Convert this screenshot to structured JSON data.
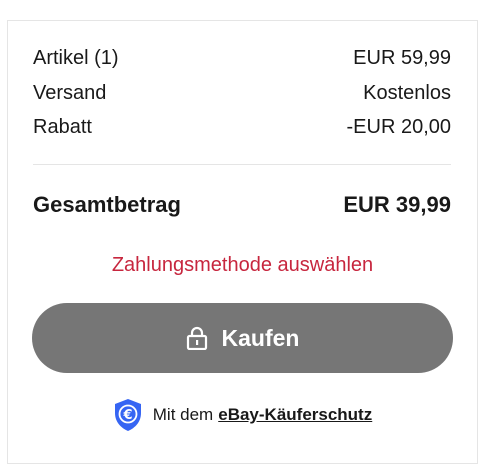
{
  "summary": {
    "items_label": "Artikel (1)",
    "items_value": "EUR 59,99",
    "shipping_label": "Versand",
    "shipping_value": "Kostenlos",
    "discount_label": "Rabatt",
    "discount_value": "-EUR 20,00",
    "total_label": "Gesamtbetrag",
    "total_value": "EUR 39,99"
  },
  "payment_warning": "Zahlungsmethode auswählen",
  "buy_button": {
    "label": "Kaufen",
    "icon": "lock-icon",
    "color": "#767676"
  },
  "protection": {
    "icon": "euro-shield-icon",
    "prefix": "Mit dem",
    "link": "eBay-Käuferschutz",
    "icon_color": "#3665f3"
  },
  "colors": {
    "warning": "#c7263e",
    "text": "#191919"
  }
}
